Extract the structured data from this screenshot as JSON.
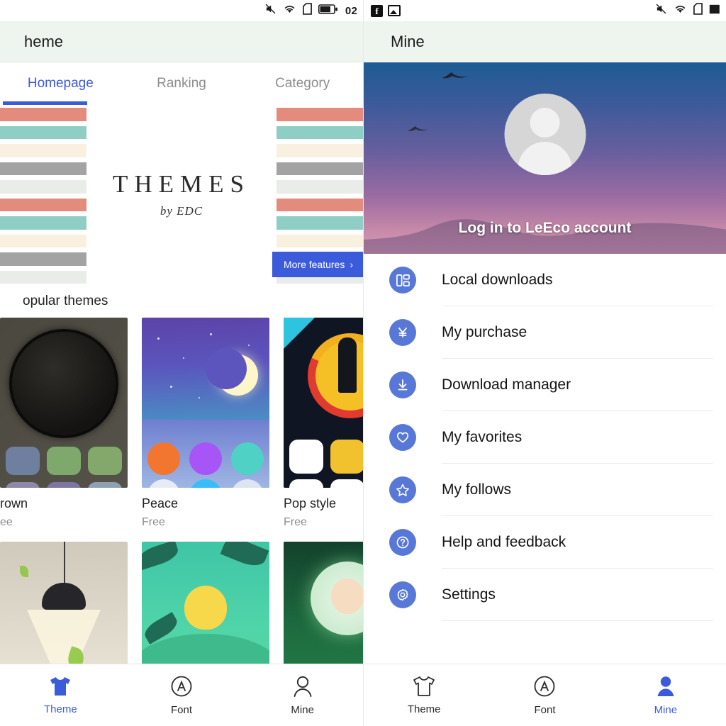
{
  "left": {
    "statusbar": {
      "icons": [
        "mute-icon",
        "wifi-icon",
        "sim-icon",
        "battery-icon"
      ],
      "clock": "02"
    },
    "header": {
      "title": "heme"
    },
    "tabs": [
      {
        "label": "Homepage",
        "active": true
      },
      {
        "label": "Ranking",
        "active": false
      },
      {
        "label": "Category",
        "active": false
      }
    ],
    "banner": {
      "title": "THEMES",
      "subtitle": "by EDC",
      "more_button": "More features",
      "chevron": "›",
      "stripe_colors": [
        "#e38b7c",
        "#8fcec4",
        "#faf0e0",
        "#a3a3a3",
        "#e9ece8",
        "#e38b7c",
        "#8fcec4",
        "#faf0e0",
        "#a3a3a3",
        "#e9ece8"
      ]
    },
    "section_title": "opular themes",
    "themes": [
      {
        "name": "rown",
        "price": "ee"
      },
      {
        "name": "Peace",
        "price": "Free"
      },
      {
        "name": "Pop style",
        "price": "Free"
      }
    ],
    "bottom_nav": [
      {
        "label": "Theme",
        "icon": "tshirt-icon",
        "active": true
      },
      {
        "label": "Font",
        "icon": "circled-a-icon",
        "active": false
      },
      {
        "label": "Mine",
        "icon": "person-icon",
        "active": false
      }
    ]
  },
  "right": {
    "statusbar": {
      "notifications": [
        "facebook-icon",
        "image-icon"
      ],
      "icons": [
        "mute-icon",
        "wifi-icon",
        "sim-icon",
        "battery-icon"
      ]
    },
    "header": {
      "title": "Mine"
    },
    "hero": {
      "login_label": "Log in to LeEco account",
      "avatar": "default-avatar"
    },
    "menu": [
      {
        "label": "Local downloads",
        "icon": "grid-layout-icon"
      },
      {
        "label": "My purchase",
        "icon": "yen-icon"
      },
      {
        "label": "Download manager",
        "icon": "download-icon"
      },
      {
        "label": "My favorites",
        "icon": "heart-icon"
      },
      {
        "label": "My follows",
        "icon": "star-icon"
      },
      {
        "label": "Help and feedback",
        "icon": "question-icon"
      },
      {
        "label": "Settings",
        "icon": "gear-icon"
      }
    ],
    "bottom_nav": [
      {
        "label": "Theme",
        "icon": "tshirt-icon",
        "active": false
      },
      {
        "label": "Font",
        "icon": "circled-a-icon",
        "active": false
      },
      {
        "label": "Mine",
        "icon": "person-icon",
        "active": true
      }
    ]
  },
  "colors": {
    "accent": "#3b5bdb",
    "icon_blue": "#5878d8",
    "header_bg": "#eef4ee",
    "muted": "#8d8d8d"
  }
}
